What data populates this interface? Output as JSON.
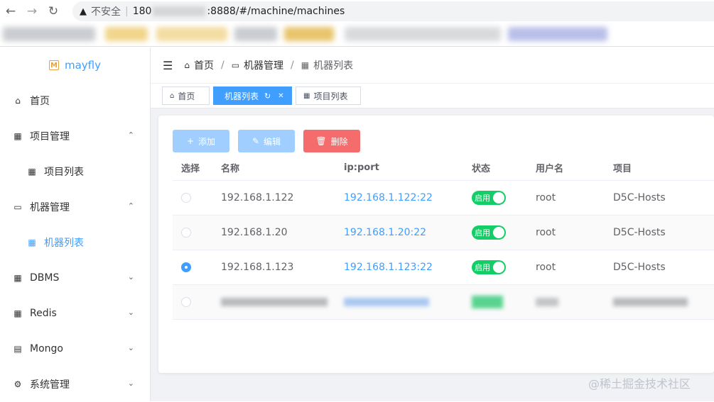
{
  "browser": {
    "back": "←",
    "forward": "→",
    "reload": "↻",
    "warning_icon": "▲",
    "insecure_label": "不安全",
    "url_prefix": "180",
    "url_suffix": ":8888/#/machine/machines"
  },
  "app": {
    "logo_mark": "M",
    "name": "mayfly"
  },
  "sidebar": {
    "items": [
      {
        "label": "首页",
        "icon": "home-icon",
        "glyph": "⌂"
      },
      {
        "label": "项目管理",
        "icon": "grid-icon",
        "glyph": "▦",
        "arrow": "⌃"
      },
      {
        "label": "项目列表",
        "icon": "grid-icon",
        "glyph": "▦"
      },
      {
        "label": "机器管理",
        "icon": "monitor-icon",
        "glyph": "▭",
        "arrow": "⌃"
      },
      {
        "label": "机器列表",
        "icon": "grid-icon",
        "glyph": "▦"
      },
      {
        "label": "DBMS",
        "icon": "database-icon",
        "glyph": "▦",
        "arrow": "⌄"
      },
      {
        "label": "Redis",
        "icon": "grid-icon",
        "glyph": "▦",
        "arrow": "⌄"
      },
      {
        "label": "Mongo",
        "icon": "document-icon",
        "glyph": "▤",
        "arrow": "⌄"
      },
      {
        "label": "系统管理",
        "icon": "gear-icon",
        "glyph": "⚙",
        "arrow": "⌄"
      }
    ]
  },
  "header": {
    "menu_glyph": "☰",
    "breadcrumb": [
      {
        "label": "首页",
        "glyph": "⌂"
      },
      {
        "label": "机器管理",
        "glyph": "▭"
      },
      {
        "label": "机器列表",
        "glyph": "▦"
      }
    ],
    "separator": "/"
  },
  "tags": [
    {
      "label": "首页",
      "glyph": "⌂"
    },
    {
      "label": "机器列表",
      "refresh": "↻",
      "close": "✕"
    },
    {
      "label": "项目列表",
      "glyph": "▦"
    }
  ],
  "toolbar": {
    "add_label": "添加",
    "add_glyph": "+",
    "edit_label": "编辑",
    "edit_glyph": "✎",
    "delete_label": "删除",
    "delete_glyph": "🗑"
  },
  "table": {
    "columns": [
      "选择",
      "名称",
      "ip:port",
      "状态",
      "用户名",
      "项目"
    ],
    "rows": [
      {
        "name": "192.168.1.122",
        "ip": "192.168.1.122:22",
        "status": "启用",
        "user": "root",
        "project": "D5C-Hosts",
        "selected": false
      },
      {
        "name": "192.168.1.20",
        "ip": "192.168.1.20:22",
        "status": "启用",
        "user": "root",
        "project": "D5C-Hosts",
        "selected": false
      },
      {
        "name": "192.168.1.123",
        "ip": "192.168.1.123:22",
        "status": "启用",
        "user": "root",
        "project": "D5C-Hosts",
        "selected": true
      }
    ]
  },
  "watermark": "@稀土掘金技术社区",
  "colors": {
    "primary": "#409eff",
    "danger": "#f56c6c",
    "success": "#13ce66"
  }
}
